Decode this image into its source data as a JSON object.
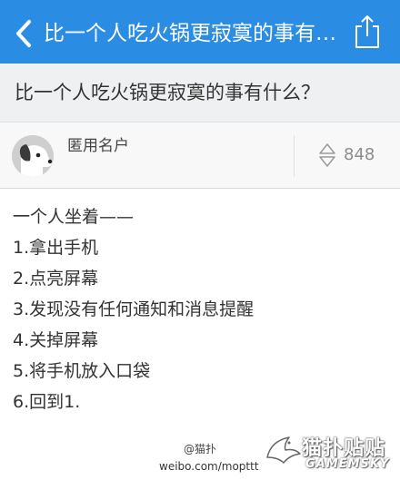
{
  "nav": {
    "title": "比一个人吃火锅更寂寞的事有…",
    "back_icon": "chevron-left-icon",
    "share_icon": "share-icon"
  },
  "question": {
    "text": "比一个人吃火锅更寂寞的事有什么？"
  },
  "answer": {
    "author": "匿用名户",
    "vote_count": "848",
    "lines": [
      "一个人坐着——",
      "1.拿出手机",
      "2.点亮屏幕",
      "3.发现没有任何通知和消息提醒",
      "4.关掉屏幕",
      "5.将手机放入口袋",
      "6.回到1."
    ]
  },
  "watermark": {
    "handle": "@猫扑",
    "url": "weibo.com/mopttt",
    "logo_cn": "猫扑贴贴",
    "logo_en": "GAMEMSKY"
  },
  "colors": {
    "nav_bar": "#2b8ce3",
    "question_bg": "#eef0f2",
    "text": "#333333",
    "vote": "#8c8c8c"
  }
}
